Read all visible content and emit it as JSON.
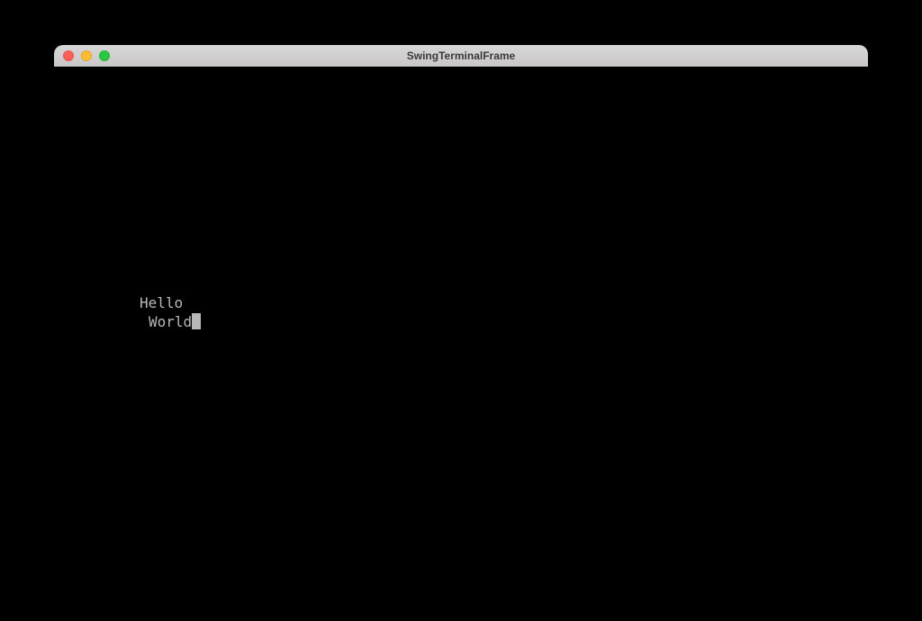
{
  "window": {
    "title": "SwingTerminalFrame"
  },
  "terminal": {
    "line1": "Hello",
    "line2": "World"
  },
  "colors": {
    "titlebar": "#c9c7c8",
    "text": "#b8b8b8",
    "background": "#000000"
  }
}
